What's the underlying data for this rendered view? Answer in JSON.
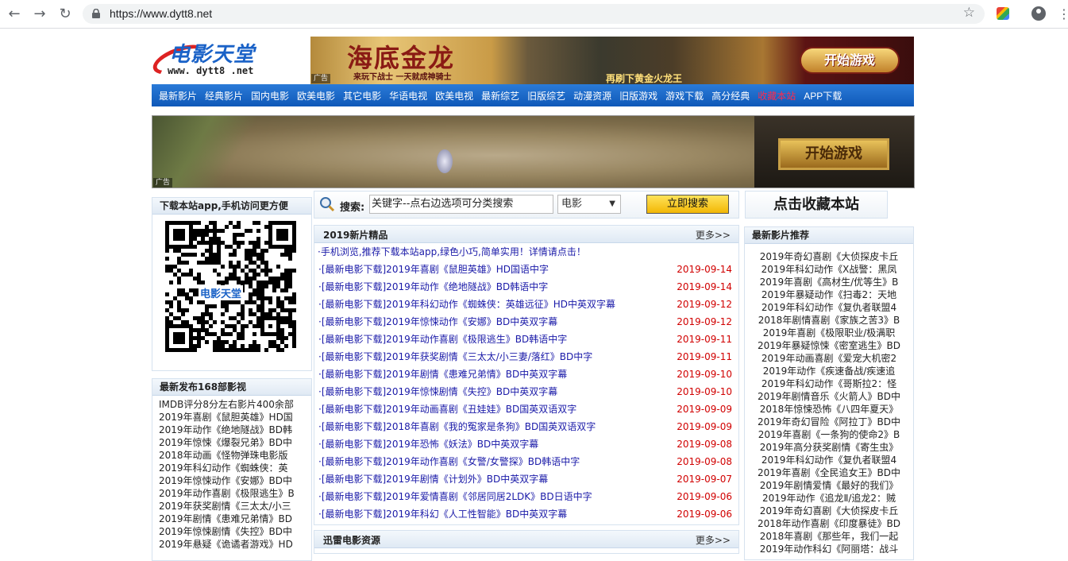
{
  "browser": {
    "url": "https://www.dytt8.net"
  },
  "logo": {
    "title": "电影天堂",
    "site": "www. dytt8 .net"
  },
  "banner_top": {
    "game_title": "海底金龙",
    "slogan_left": "来玩下战士 一天就成神骑士",
    "slogan_mid": "再刷下黄金火龙王",
    "play_label": "开始游戏",
    "ad_label": "广告"
  },
  "menu": [
    "最新影片",
    "经典影片",
    "国内电影",
    "欧美电影",
    "其它电影",
    "华语电视",
    "欧美电视",
    "最新综艺",
    "旧版综艺",
    "动漫资源",
    "旧版游戏",
    "游戏下载",
    "高分经典",
    "收藏本站",
    "APP下载"
  ],
  "banner_mid": {
    "play_label": "开始游戏",
    "ad_label": "广告"
  },
  "sidebar_app": {
    "heading": "下载本站app,手机访问更方便",
    "qr_text": "电影天堂"
  },
  "sidebar_latest": {
    "heading": "最新发布168部影视",
    "items": [
      "IMDB评分8分左右影片400余部",
      "2019年喜剧《鼠胆英雄》HD国",
      "2019年动作《绝地隧战》BD韩",
      "2019年惊悚《爆裂兄弟》BD中",
      "2018年动画《怪物弹珠电影版",
      "2019年科幻动作《蜘蛛侠：英",
      "2019年惊悚动作《安娜》BD中",
      "2019年动作喜剧《极限逃生》B",
      "2019年获奖剧情《三太太/小三",
      "2019年剧情《患难兄弟情》BD",
      "2019年惊悚剧情《失控》BD中",
      "2019年悬疑《诡谲者游戏》HD"
    ]
  },
  "search": {
    "label": "搜索:",
    "placeholder": "关键字--点右边选项可分类搜索",
    "category": "电影",
    "button": "立即搜索"
  },
  "favorite": {
    "label": "点击收藏本站"
  },
  "new_2019": {
    "heading": "2019新片精品",
    "more": "更多>>",
    "notice": "·手机浏览,推荐下载本站app,绿色小巧,简单实用！详情请点击！",
    "rows": [
      {
        "title": "·[最新电影下载]2019年喜剧《鼠胆英雄》HD国语中字",
        "date": "2019-09-14"
      },
      {
        "title": "·[最新电影下载]2019年动作《绝地隧战》BD韩语中字",
        "date": "2019-09-14"
      },
      {
        "title": "·[最新电影下载]2019年科幻动作《蜘蛛侠：英雄远征》HD中英双字幕",
        "date": "2019-09-12"
      },
      {
        "title": "·[最新电影下载]2019年惊悚动作《安娜》BD中英双字幕",
        "date": "2019-09-12"
      },
      {
        "title": "·[最新电影下载]2019年动作喜剧《极限逃生》BD韩语中字",
        "date": "2019-09-11"
      },
      {
        "title": "·[最新电影下载]2019年获奖剧情《三太太/小三妻/落红》BD中字",
        "date": "2019-09-11"
      },
      {
        "title": "·[最新电影下载]2019年剧情《患难兄弟情》BD中英双字幕",
        "date": "2019-09-10"
      },
      {
        "title": "·[最新电影下载]2019年惊悚剧情《失控》BD中英双字幕",
        "date": "2019-09-10"
      },
      {
        "title": "·[最新电影下载]2019年动画喜剧《丑娃娃》BD国英双语双字",
        "date": "2019-09-09"
      },
      {
        "title": "·[最新电影下载]2018年喜剧《我的冤家是条狗》BD国英双语双字",
        "date": "2019-09-09"
      },
      {
        "title": "·[最新电影下载]2019年恐怖《妖法》BD中英双字幕",
        "date": "2019-09-08"
      },
      {
        "title": "·[最新电影下载]2019年动作喜剧《女警/女警探》BD韩语中字",
        "date": "2019-09-08"
      },
      {
        "title": "·[最新电影下载]2019年剧情《计划外》BD中英双字幕",
        "date": "2019-09-07"
      },
      {
        "title": "·[最新电影下载]2019年爱情喜剧《邻居同居2LDK》BD日语中字",
        "date": "2019-09-06"
      },
      {
        "title": "·[最新电影下载]2019年科幻《人工性智能》BD中英双字幕",
        "date": "2019-09-06"
      }
    ]
  },
  "xunlei": {
    "heading": "迅雷电影资源",
    "more": "更多>>"
  },
  "recommend": {
    "heading": "最新影片推荐",
    "items": [
      "2019年奇幻喜剧《大侦探皮卡丘",
      "2019年科幻动作《X战警：黑凤",
      "2019年喜剧《高材生/优等生》B",
      "2019年暴疑动作《扫毒2：天地",
      "2019年科幻动作《复仇者联盟4",
      "2018年剧情喜剧《家族之苦3》B",
      "2019年喜剧《极限职业/极满职",
      "2019年暴疑惊悚《密室逃生》BD",
      "2019年动画喜剧《爱宠大机密2",
      "2019年动作《疾速备战/疾速追",
      "2019年科幻动作《哥斯拉2：怪",
      "2019年剧情音乐《火箭人》BD中",
      "2018年惊悚恐怖《八四年夏天》",
      "2019年奇幻冒险《阿拉丁》BD中",
      "2019年喜剧《一条狗的使命2》B",
      "2019年高分获奖剧情《寄生虫》",
      "2019年科幻动作《复仇者联盟4",
      "2019年喜剧《全民追女王》BD中",
      "2019年剧情爱情《最好的我们》",
      "2019年动作《追龙Ⅱ/追龙2：贼",
      "2019年奇幻喜剧《大侦探皮卡丘",
      "2018年动作喜剧《印度暴徒》BD",
      "2018年喜剧《那些年，我们一起",
      "2019年动作科幻《阿丽塔：战斗"
    ]
  },
  "colors": {
    "menu_blue": "#1a62c7",
    "date_red": "#d10000",
    "link_blue": "#1a1aa8",
    "highlight": "#ff2a4d"
  }
}
